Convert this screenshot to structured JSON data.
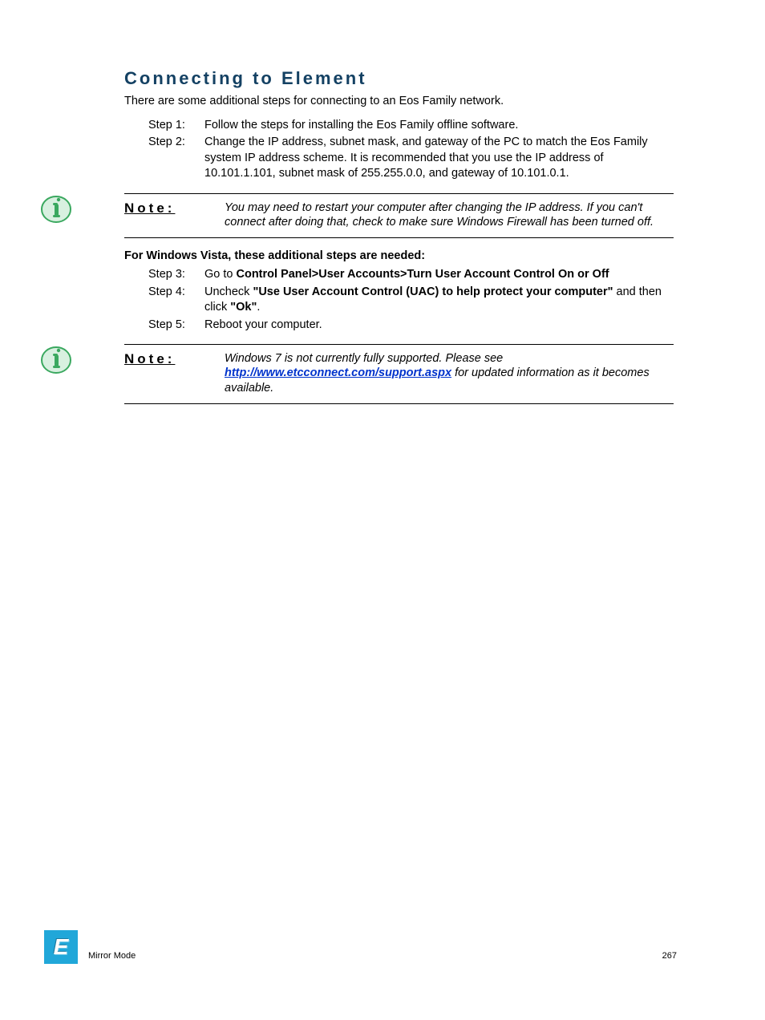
{
  "section_title": "Connecting to Element",
  "intro": "There are some additional steps for connecting to an Eos Family network.",
  "step1_label": "Step 1:",
  "step1_text": "Follow the steps for installing the Eos Family offline software.",
  "step2_label": "Step 2:",
  "step2_text": "Change the IP address, subnet mask, and gateway of the PC to match the Eos Family system IP address scheme. It is recommended that you use the IP address of 10.101.1.101, subnet mask of 255.255.0.0, and gateway of 10.101.0.1.",
  "note1": {
    "label": "Note:",
    "text": "You may need to restart your computer after changing the IP address. If you can't connect after doing that, check to make sure Windows Firewall has been turned off."
  },
  "vista_heading": "For Windows Vista, these additional steps are needed:",
  "step3_label": "Step 3:",
  "step3_pre": "Go to ",
  "step3_bold": "Control Panel>User Accounts>Turn User Account Control On or Off",
  "step4_label": "Step 4:",
  "step4_pre": "Uncheck ",
  "step4_bold1": "\"Use User Account Control (UAC) to help protect your computer\"",
  "step4_mid": " and then click ",
  "step4_bold2": "\"Ok\"",
  "step4_post": ".",
  "step5_label": "Step 5:",
  "step5_text": "Reboot your computer.",
  "note2": {
    "label": "Note:",
    "pre": "Windows 7 is not currently fully supported. Please see ",
    "link1_text": "http://",
    "link2_text": "www.etcconnect.com/support.aspx",
    "post": " for updated information as it becomes available."
  },
  "footer": {
    "section": "Mirror Mode",
    "page": "267",
    "badge": "E"
  }
}
